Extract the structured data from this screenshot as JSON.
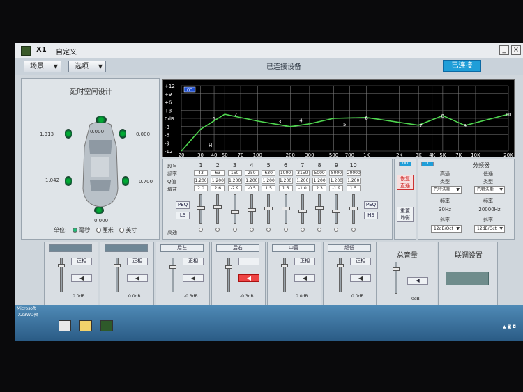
{
  "title": {
    "app": "X1",
    "preset": "自定义"
  },
  "menu": {
    "scene": "场景",
    "options": "选项"
  },
  "status": {
    "text": "已连接设备",
    "connect_button": "已连接"
  },
  "window_controls": {
    "minimize": "_",
    "close": "×"
  },
  "delay_panel": {
    "title": "延时空间设计",
    "values": {
      "front_left_outer": "1.313",
      "center_top": "0.000",
      "front_right": "0.000",
      "rear_left": "1.042",
      "rear_right": "0.700",
      "sub": "0.000"
    },
    "unit_label": "单位:",
    "units": [
      "毫秒",
      "厘米",
      "英寸"
    ]
  },
  "graph": {
    "y_ticks": [
      "+12",
      "+9",
      "+6",
      "+3",
      "0dB",
      "-3",
      "-6",
      "-9",
      "-12"
    ],
    "x_ticks": [
      "20",
      "30",
      "40",
      "50",
      "70",
      "100",
      "200",
      "300",
      "500",
      "700",
      "1K",
      "2K",
      "3K",
      "4K",
      "5K",
      "7K",
      "10K",
      "20K"
    ],
    "badge": "OO",
    "h_marker": "H",
    "band_markers": [
      "1",
      "2",
      "3",
      "4",
      "5",
      "6",
      "7",
      "8",
      "9",
      "10"
    ]
  },
  "chart_data": {
    "type": "line",
    "x": [
      20,
      30,
      50,
      100,
      200,
      300,
      500,
      1000,
      3000,
      5000,
      8000,
      20000
    ],
    "series": [
      {
        "values": [
          -12,
          -4,
          1.5,
          -1,
          -3,
          -2,
          0,
          0.3,
          -2.5,
          1,
          -2.6,
          1.5
        ]
      }
    ],
    "xlabel": "",
    "ylabel": "",
    "ylim": [
      -12,
      12
    ],
    "xscale": "log",
    "grid": true
  },
  "eq": {
    "row_labels": {
      "band": "段号",
      "freq": "频率",
      "q": "Q值",
      "gain": "增益",
      "high_pass": "高通"
    },
    "bands": [
      "1",
      "2",
      "3",
      "4",
      "5",
      "6",
      "7",
      "8",
      "9",
      "10"
    ],
    "freqs": [
      "43",
      "63",
      "160",
      "250",
      "630",
      "1000",
      "3150",
      "5000",
      "8000",
      "20000"
    ],
    "qs": [
      "1.200",
      "1.200",
      "1.200",
      "1.200",
      "1.200",
      "1.200",
      "1.200",
      "1.200",
      "1.200",
      "1.200"
    ],
    "gains": [
      "2.0",
      "2.6",
      "-2.9",
      "-0.5",
      "1.5",
      "1.6",
      "-1.0",
      "2.3",
      "-1.9",
      "1.5"
    ],
    "slider_levels": [
      0.58,
      0.6,
      0.42,
      0.5,
      0.56,
      0.56,
      0.46,
      0.58,
      0.44,
      0.56
    ],
    "peq_label": "PEQ",
    "ls_label": "LS",
    "hs_label": "HS"
  },
  "actions": {
    "reset_eq": "恢复\n直通",
    "balance": "重置\n均衡",
    "badge": "OO"
  },
  "crossover": {
    "title": "分频器",
    "badge": "OO",
    "hp_label": "高通",
    "lp_label": "低通",
    "type_label": "类型",
    "type_hp": "巴特沃斯",
    "type_lp": "巴特沃斯",
    "freq_label": "频率",
    "freq_hp": "30Hz",
    "freq_lp": "20000Hz",
    "slope_label": "斜率",
    "slope_hp": "12dB/Oct",
    "slope_lp": "12dB/Oct"
  },
  "channels": [
    {
      "name": "",
      "mute": "正相",
      "db": "0.0dB",
      "active": true,
      "level": 0.8
    },
    {
      "name": "",
      "mute": "正相",
      "db": "0.0dB",
      "active": true,
      "level": 0.8
    },
    {
      "name": "后左",
      "mute": "正相",
      "db": "-0.3dB",
      "active": false,
      "level": 0.75
    },
    {
      "name": "后右",
      "mute": "",
      "db": "-0.3dB",
      "active": false,
      "level": 0.75
    },
    {
      "name": "中置",
      "mute": "正相",
      "db": "0.0dB",
      "active": false,
      "level": 0.8
    },
    {
      "name": "超低",
      "mute": "正相",
      "db": "0.0dB",
      "active": false,
      "level": 0.8
    }
  ],
  "master": {
    "title": "总音量",
    "db": "0dB",
    "level": 0.8
  },
  "link": {
    "title": "联调设置"
  },
  "taskbar": {
    "corner_text": "Microsoft\n XZ3WD预"
  }
}
